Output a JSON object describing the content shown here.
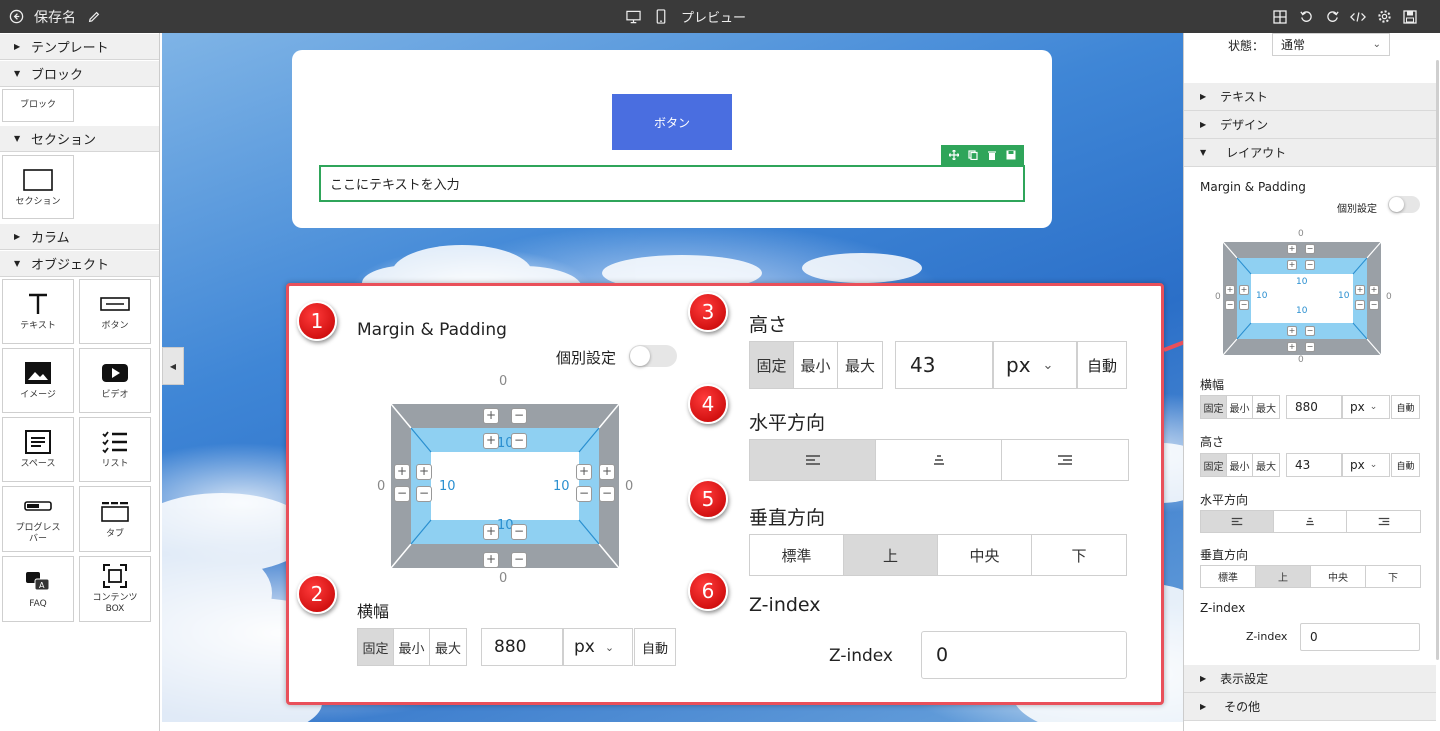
{
  "app": {
    "title": "保存名",
    "preview_label": "プレビュー"
  },
  "left_sidebar": {
    "sections": [
      {
        "label": "テンプレート",
        "expanded": false
      },
      {
        "label": "ブロック",
        "expanded": true,
        "items": [
          "ブロック"
        ]
      },
      {
        "label": "セクション",
        "expanded": true,
        "items": [
          "セクション"
        ]
      },
      {
        "label": "カラム",
        "expanded": false
      },
      {
        "label": "オブジェクト",
        "expanded": true
      }
    ],
    "objects": [
      {
        "label": "テキスト",
        "icon": "text-icon"
      },
      {
        "label": "ボタン",
        "icon": "button-icon"
      },
      {
        "label": "イメージ",
        "icon": "image-icon"
      },
      {
        "label": "ビデオ",
        "icon": "video-icon"
      },
      {
        "label": "スペース",
        "icon": "space-icon"
      },
      {
        "label": "リスト",
        "icon": "list-icon"
      },
      {
        "label": "プログレス\nバー",
        "icon": "progress-bar-icon"
      },
      {
        "label": "タブ",
        "icon": "tab-icon"
      },
      {
        "label": "FAQ",
        "icon": "faq-icon"
      },
      {
        "label": "コンテンツ\nBOX",
        "icon": "content-box-icon"
      }
    ]
  },
  "canvas": {
    "button_label": "ボタン",
    "text_placeholder": "ここにテキストを入力"
  },
  "callout": {
    "badges": [
      "1",
      "2",
      "3",
      "4",
      "5",
      "6"
    ],
    "margin_padding_title": "Margin & Padding",
    "individual_label": "個別設定",
    "box": {
      "margin_top": "0",
      "margin_bottom": "0",
      "margin_left": "0",
      "margin_right": "0",
      "padding_top": "10",
      "padding_bottom": "10",
      "padding_left": "10",
      "padding_right": "10"
    },
    "width_title": "横幅",
    "size_modes": [
      "固定",
      "最小",
      "最大"
    ],
    "width_value": "880",
    "unit": "px",
    "auto_label": "自動",
    "height_title": "高さ",
    "height_value": "43",
    "horizontal_title": "水平方向",
    "vertical_title": "垂直方向",
    "vertical_options": [
      "標準",
      "上",
      "中央",
      "下"
    ],
    "zindex_title": "Z-index",
    "zindex_label": "Z-index",
    "zindex_value": "0"
  },
  "right_panel": {
    "state_label": "状態：",
    "state_value": "通常",
    "sections": [
      "テキスト",
      "デザイン",
      "レイアウト"
    ],
    "margin_padding_title": "Margin & Padding",
    "individual_label": "個別設定",
    "box": {
      "margin_top": "0",
      "margin_bottom": "0",
      "margin_left": "0",
      "margin_right": "0",
      "padding_top": "10",
      "padding_bottom": "10",
      "padding_left": "10",
      "padding_right": "10"
    },
    "width_title": "横幅",
    "size_modes": [
      "固定",
      "最小",
      "最大"
    ],
    "width_value": "880",
    "unit": "px",
    "auto_label": "自動",
    "height_title": "高さ",
    "height_value": "43",
    "horizontal_title": "水平方向",
    "vertical_title": "垂直方向",
    "vertical_options": [
      "標準",
      "上",
      "中央",
      "下"
    ],
    "zindex_title": "Z-index",
    "zindex_label": "Z-index",
    "zindex_value": "0",
    "bottom_sections": [
      "表示設定",
      "その他"
    ]
  },
  "colors": {
    "accent_green": "#2fa55a",
    "button_blue": "#4a6ee0",
    "callout_red": "#e9505a"
  }
}
